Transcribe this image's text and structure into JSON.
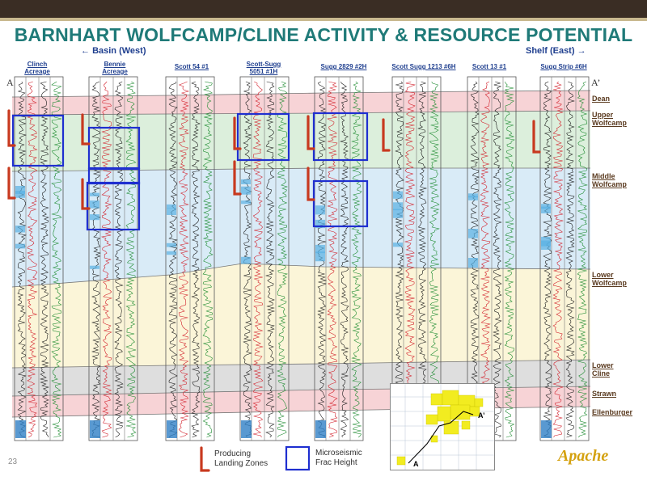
{
  "title": "BARNHART WOLFCAMP/CLINE ACTIVITY & RESOURCE POTENTIAL",
  "directions": {
    "left": "Basin (West)",
    "right": "Shelf (East)"
  },
  "section_ends": {
    "left": "A",
    "right": "A’"
  },
  "wells": [
    {
      "name": "Clinch Acreage"
    },
    {
      "name": "Bennie Acreage"
    },
    {
      "name": "Scott 54 #1"
    },
    {
      "name": "Scott-Sugg 5051 #1H"
    },
    {
      "name": "Sugg 2829 #2H"
    },
    {
      "name": "Scott Sugg 1213 #6H"
    },
    {
      "name": "Scott 13 #1"
    },
    {
      "name": "Sugg Strip #6H"
    }
  ],
  "zones": [
    {
      "name": "Dean"
    },
    {
      "name": "Upper Wolfcamp"
    },
    {
      "name": "Middle Wolfcamp"
    },
    {
      "name": "Lower Wolfcamp"
    },
    {
      "name": "Lower Cline"
    },
    {
      "name": "Strawn"
    },
    {
      "name": "Ellenburger"
    }
  ],
  "legend": {
    "producing": "Producing Landing Zones",
    "microseismic": "Microseismic Frac Height"
  },
  "map": {
    "label_a": "A",
    "label_a_prime": "A’"
  },
  "page_number": "23",
  "logo": "Apache",
  "colors": {
    "title": "#1f7a78",
    "well_label": "#1f3f8f",
    "zone_label": "#5a3a1f",
    "frac_box": "#1f2fd0",
    "landing": "#c8391f",
    "band_pink": "#f7d3d6",
    "band_green": "#dcefdc",
    "band_blue": "#d9ebf7",
    "band_yellow": "#fbf5d8",
    "band_grey": "#dedede",
    "map_acreage": "#f2ec20"
  }
}
